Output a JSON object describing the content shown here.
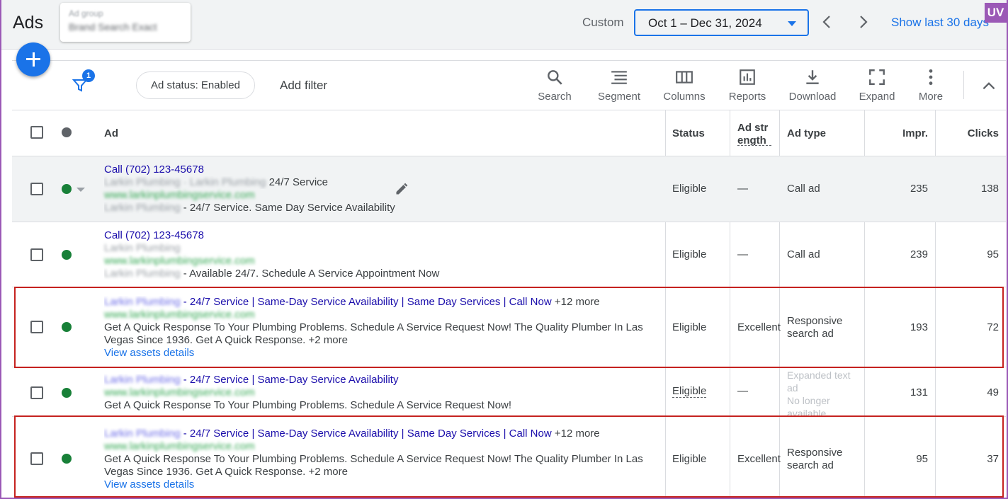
{
  "header": {
    "app_title": "Ads",
    "ad_group_label": "Ad group",
    "ad_group_value": "Brand Search Exact",
    "range_label": "Custom",
    "date_range": "Oct 1 – Dec 31, 2024",
    "show_last": "Show last 30 days",
    "badge": "UV"
  },
  "toolbar": {
    "filter_count": "1",
    "status_chip": "Ad status: Enabled",
    "add_filter": "Add filter",
    "tools": [
      "Search",
      "Segment",
      "Columns",
      "Reports",
      "Download",
      "Expand",
      "More"
    ]
  },
  "columns": {
    "ad": "Ad",
    "status": "Status",
    "ad_strength": "Ad strength",
    "ad_type": "Ad type",
    "impr": "Impr.",
    "clicks": "Clicks"
  },
  "rows": [
    {
      "headline": "Call (702) 123-45678",
      "business_name": "Larkin Plumbing · Larkin Plumbing",
      "business_suffix": "24/7 Service",
      "url": "www.larkinplumbingservice.com",
      "desc_name": "Larkin Plumbing",
      "description": " - 24/7 Service. Same Day Service Availability",
      "status": "Eligible",
      "ad_strength": "—",
      "ad_type": "Call ad",
      "impr": "235",
      "clicks": "138"
    },
    {
      "headline": "Call (702) 123-45678",
      "business_name": "Larkin Plumbing",
      "url": "www.larkinplumbingservice.com",
      "desc_name": "Larkin Plumbing",
      "description": " - Available 24/7. Schedule A Service Appointment Now",
      "status": "Eligible",
      "ad_strength": "—",
      "ad_type": "Call ad",
      "impr": "239",
      "clicks": "95"
    },
    {
      "headline_name": "Larkin Plumbing",
      "headline": " - 24/7 Service | Same-Day Service Availability | Same Day Services | Call Now",
      "headline_more": "+12 more",
      "url": "www.larkinplumbingservice.com",
      "description_1": "Get A Quick Response To Your Plumbing Problems. Schedule A Service Request Now! The Quality Plumber In Las",
      "description_2": "Vegas Since 1936. Get A Quick Response.",
      "description_more": "+2 more",
      "assets_link": "View assets details",
      "status": "Eligible",
      "ad_strength": "Excellent",
      "ad_type_1": "Responsive",
      "ad_type_2": "search ad",
      "impr": "193",
      "clicks": "72"
    },
    {
      "headline_name": "Larkin Plumbing",
      "headline": " - 24/7 Service | Same-Day Service Availability",
      "url": "www.larkinplumbingservice.com",
      "description_1": "Get A Quick Response To Your Plumbing Problems. Schedule A Service Request Now!",
      "status": "Eligible",
      "ad_strength": "—",
      "ad_type_1": "Expanded text",
      "ad_type_2": "ad",
      "ad_type_3": "No longer",
      "ad_type_4": "available",
      "impr": "131",
      "clicks": "49"
    },
    {
      "headline_name": "Larkin Plumbing",
      "headline": " - 24/7 Service | Same-Day Service Availability | Same Day Services | Call Now",
      "headline_more": "+12 more",
      "url": "www.larkinplumbingservice.com",
      "description_1": "Get A Quick Response To Your Plumbing Problems. Schedule A Service Request Now! The Quality Plumber In Las",
      "description_2": "Vegas Since 1936. Get A Quick Response.",
      "description_more": "+2 more",
      "assets_link": "View assets details",
      "status": "Eligible",
      "ad_strength": "Excellent",
      "ad_type_1": "Responsive",
      "ad_type_2": "search ad",
      "impr": "95",
      "clicks": "37"
    }
  ],
  "icons": {
    "filter": "filter-icon",
    "search": "search-icon",
    "segment": "segment-icon",
    "columns": "columns-icon",
    "reports": "reports-icon",
    "download": "download-icon",
    "expand": "expand-icon",
    "more": "more-vert-icon",
    "collapse": "chevron-up-icon",
    "edit": "pencil-icon"
  },
  "colors": {
    "accent": "#1a73e8",
    "enabled_dot": "#188038",
    "highlight": "#c5221f",
    "frame": "#9b59b6"
  }
}
